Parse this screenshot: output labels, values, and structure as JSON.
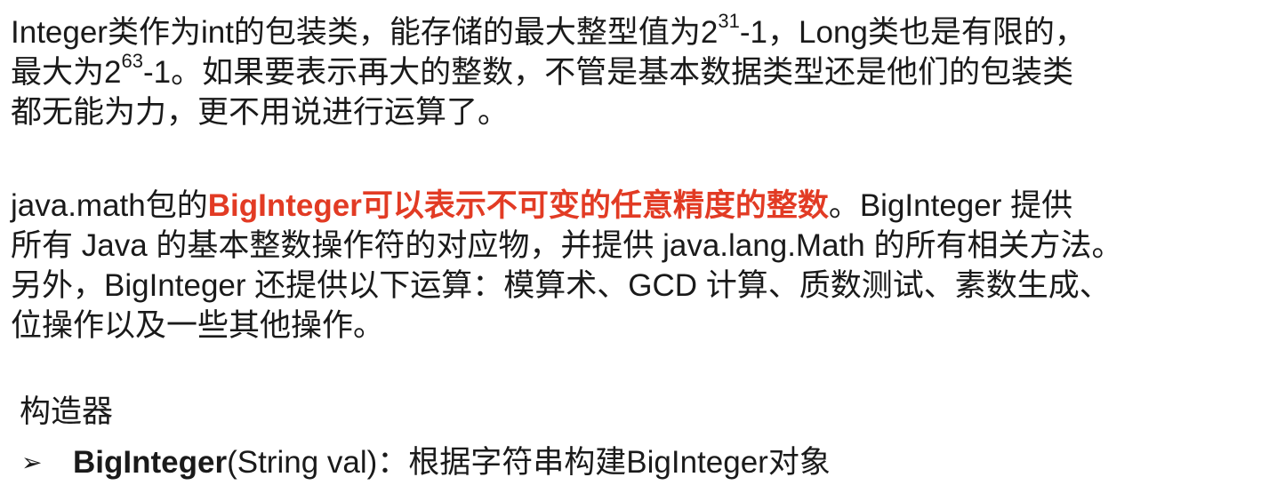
{
  "intro": {
    "line1_a": "Integer类作为int的包装类，能存储的最大整型值为2",
    "line1_sup": "31",
    "line1_b": "-1，Long类也是有限的，",
    "line2_a": "最大为2",
    "line2_sup": "63",
    "line2_b": "-1。如果要表示再大的整数，不管是基本数据类型还是他们的包装类",
    "line3": "都无能为力，更不用说进行运算了。"
  },
  "biginteger": {
    "prefix": "java.math包的",
    "highlight": "BigInteger可以表示不可变的任意精度的整数",
    "suffix": "。BigInteger 提供",
    "line2": "所有 Java 的基本整数操作符的对应物，并提供 java.lang.Math 的所有相关方法。",
    "line3": "另外，BigInteger 还提供以下运算：模算术、GCD 计算、质数测试、素数生成、",
    "line4": "位操作以及一些其他操作。"
  },
  "constructor": {
    "heading": "构造器",
    "bullet_symbol": "➢",
    "name": "BigInteger",
    "signature": "(String val)：根据字符串构建BigInteger对象"
  },
  "colors": {
    "highlight": "#e23b24",
    "text": "#1a1a1a"
  }
}
